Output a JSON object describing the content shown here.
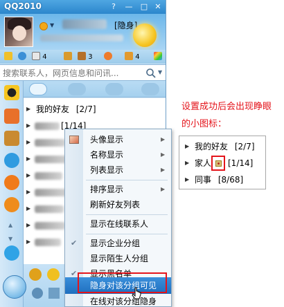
{
  "window": {
    "title": "QQ2010"
  },
  "profile": {
    "status_label": "[隐身]"
  },
  "toolbar": {
    "count_a": "3",
    "count_b": "4",
    "count_c": "4"
  },
  "search": {
    "placeholder": "搜索联系人，网页信息和问讯..."
  },
  "contacts": {
    "groups": [
      {
        "name": "我的好友",
        "count": "[2/7]"
      },
      {
        "name": "",
        "count": "[1/14]"
      }
    ]
  },
  "menu": {
    "items": [
      {
        "label": "头像显示",
        "submenu": true,
        "checked": false
      },
      {
        "label": "名称显示",
        "submenu": true,
        "checked": false
      },
      {
        "label": "列表显示",
        "submenu": true,
        "checked": false
      },
      {
        "label": "排序显示",
        "submenu": true,
        "checked": false
      },
      {
        "label": "刷新好友列表",
        "submenu": false,
        "checked": false
      },
      {
        "label": "显示在线联系人",
        "submenu": false,
        "checked": false
      },
      {
        "label": "显示企业分组",
        "submenu": false,
        "checked": true
      },
      {
        "label": "显示陌生人分组",
        "submenu": false,
        "checked": false
      },
      {
        "label": "显示黑名单",
        "submenu": false,
        "checked": true
      },
      {
        "label": "隐身对该分组可见",
        "submenu": false,
        "checked": false,
        "highlighted": true
      },
      {
        "label": "在线对该分组隐身",
        "submenu": false,
        "checked": false
      }
    ]
  },
  "annotation": {
    "note_line1": "设置成功后会出现睁眼",
    "note_line2": "的小图标：",
    "example_rows": [
      {
        "label": "我的好友",
        "count": "[2/7]"
      },
      {
        "label": "家人",
        "count": "[1/14]"
      },
      {
        "label": "同事",
        "count": "[8/68]"
      }
    ]
  },
  "colors": {
    "accent": "#2b86cc",
    "highlight": "#1f6fbf",
    "annotation_red": "#e4141b"
  }
}
